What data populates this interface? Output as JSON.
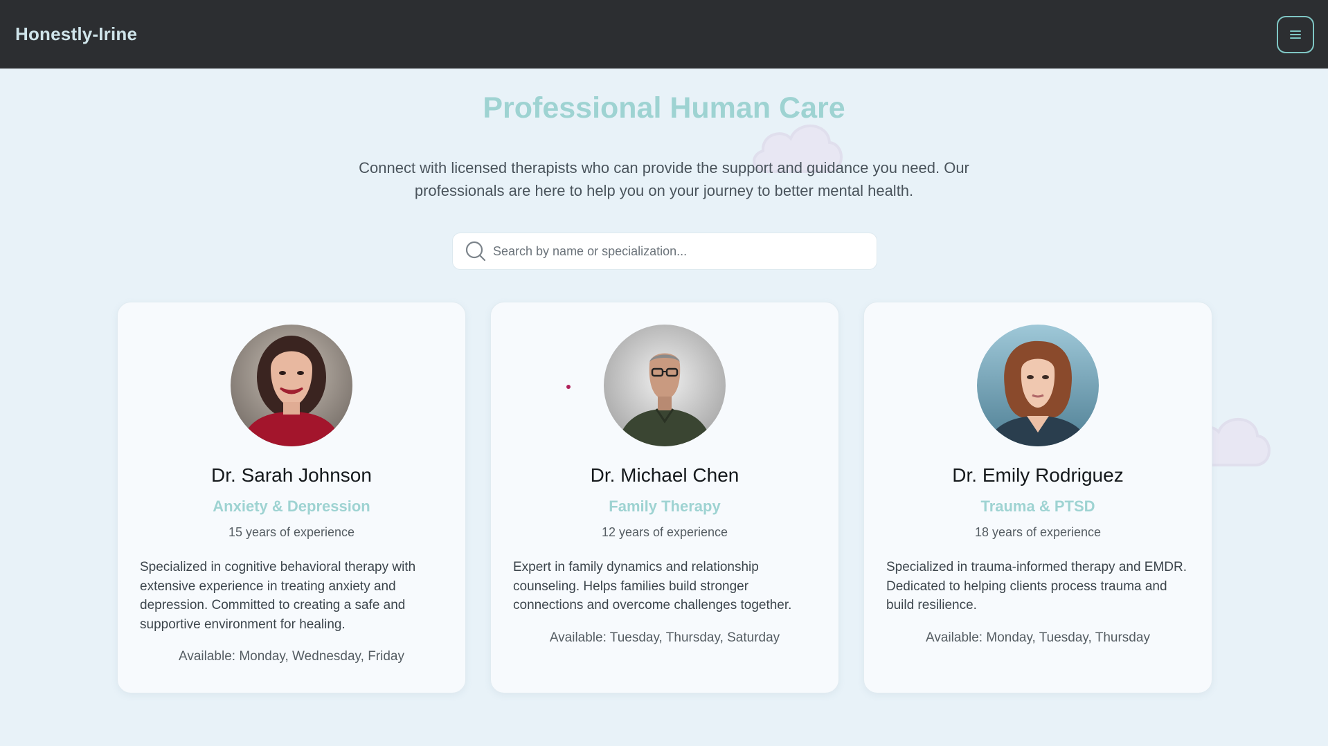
{
  "header": {
    "brand": "Honestly-Irine",
    "menu_icon": "hamburger-icon"
  },
  "hero": {
    "title": "Professional Human Care",
    "description": "Connect with licensed therapists who can provide the support and guidance you need. Our professionals are here to help you on your journey to better mental health."
  },
  "search": {
    "placeholder": "Search by name or specialization...",
    "value": "",
    "icon": "search-icon"
  },
  "colors": {
    "accent": "#9ed3d2",
    "topbar": "#2c2e31",
    "background": "#e8f2f8"
  },
  "therapists": [
    {
      "name": "Dr. Sarah Johnson",
      "specialization": "Anxiety & Depression",
      "experience": "15 years of experience",
      "description": "Specialized in cognitive behavioral therapy with extensive experience in treating anxiety and depression. Committed to creating a safe and supportive environment for healing.",
      "availability": "Available: Monday, Wednesday, Friday"
    },
    {
      "name": "Dr. Michael Chen",
      "specialization": "Family Therapy",
      "experience": "12 years of experience",
      "description": "Expert in family dynamics and relationship counseling. Helps families build stronger connections and overcome challenges together.",
      "availability": "Available: Tuesday, Thursday, Saturday"
    },
    {
      "name": "Dr. Emily Rodriguez",
      "specialization": "Trauma & PTSD",
      "experience": "18 years of experience",
      "description": "Specialized in trauma-informed therapy and EMDR. Dedicated to helping clients process trauma and build resilience.",
      "availability": "Available: Monday, Tuesday, Thursday"
    }
  ]
}
